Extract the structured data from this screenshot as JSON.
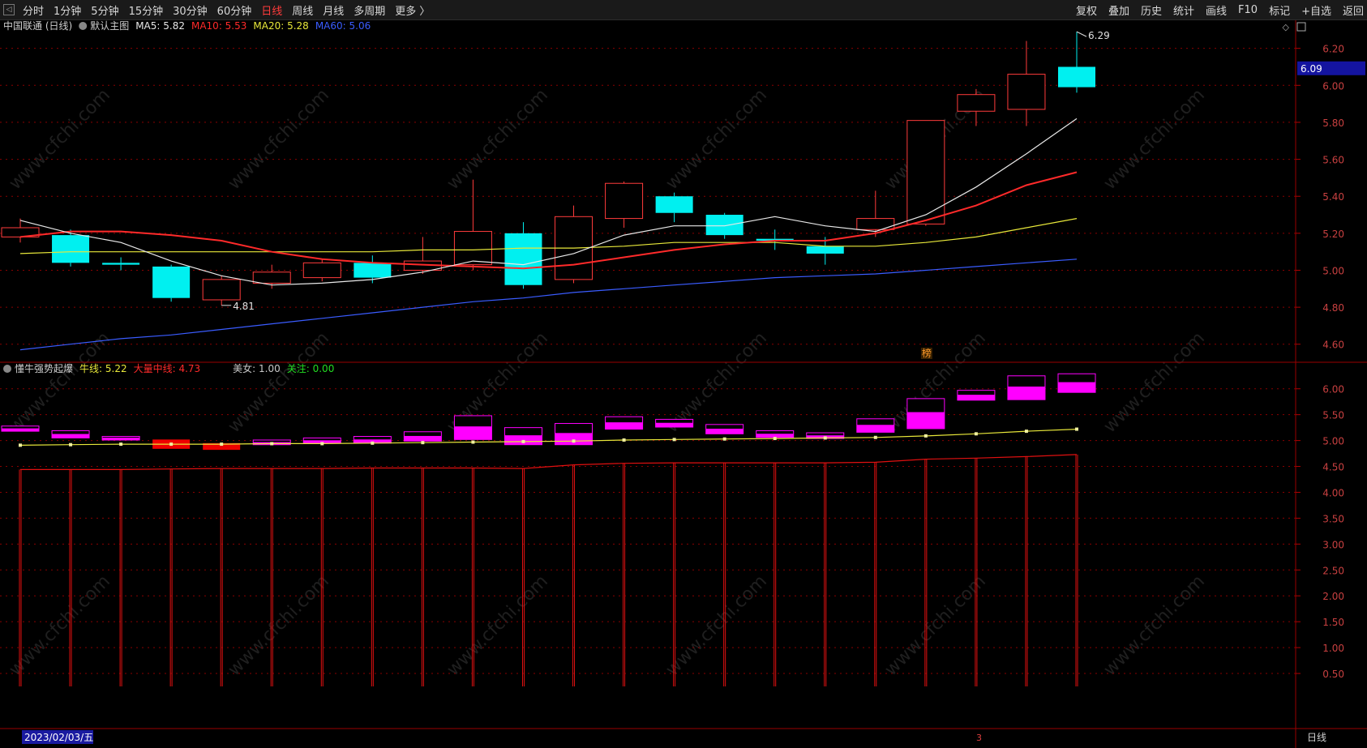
{
  "toolbar": {
    "collapse_icon": "chevron-left-icon",
    "periods": [
      "分时",
      "1分钟",
      "5分钟",
      "15分钟",
      "30分钟",
      "60分钟",
      "日线",
      "周线",
      "月线",
      "多周期",
      "更多 〉"
    ],
    "active_period": "日线",
    "right_items": [
      "复权",
      "叠加",
      "历史",
      "统计",
      "画线",
      "F10",
      "标记",
      "+自选",
      "返回"
    ]
  },
  "main_panel": {
    "title": "中国联通 (日线)",
    "template_icon": "gear-icon",
    "template": "默认主图",
    "indicators": [
      {
        "label": "MA5: 5.82",
        "color": "#e8e8e8"
      },
      {
        "label": "MA10: 5.53",
        "color": "#ff2a2a"
      },
      {
        "label": "MA20: 5.28",
        "color": "#e8e83a"
      },
      {
        "label": "MA60: 5.06",
        "color": "#3a5cff"
      }
    ],
    "y_ticks": [
      "6.20",
      "6.00",
      "5.80",
      "5.60",
      "5.40",
      "5.20",
      "5.00",
      "4.80",
      "4.60"
    ],
    "current_price": "6.09",
    "high_label": "6.29",
    "low_label": "4.81",
    "marker": "榜",
    "corner_icons": [
      "diamond-icon",
      "window-icon"
    ]
  },
  "sub_panel": {
    "title": "懂牛强势起爆",
    "indicators": [
      {
        "label": "牛线: 5.22",
        "color": "#e8e83a"
      },
      {
        "label": "大量中线: 4.73",
        "color": "#ff2a2a"
      },
      {
        "label": "美女: 1.00",
        "color": "#c8c8c8"
      },
      {
        "label": "关注: 0.00",
        "color": "#22dd22"
      }
    ],
    "y_ticks": [
      "6.00",
      "5.50",
      "5.00",
      "4.50",
      "4.00",
      "3.50",
      "3.00",
      "2.50",
      "2.00",
      "1.50",
      "1.00",
      "0.50"
    ]
  },
  "status_bar": {
    "date": "2023/02/03/五",
    "marker": "3",
    "period": "日线"
  },
  "watermark": "www.cfchi.com",
  "colors": {
    "up": "#ff3b3b",
    "down": "#00f0f0",
    "ma5": "#e8e8e8",
    "ma10": "#ff2a2a",
    "ma20": "#e8e83a",
    "ma60": "#3a5cff",
    "sub_up": "#ff00ff",
    "grid": "#8a0000"
  },
  "chart_data": {
    "type": "candlestick",
    "candles": [
      {
        "o": 5.18,
        "c": 5.23,
        "h": 5.28,
        "l": 5.15
      },
      {
        "o": 5.19,
        "c": 5.04,
        "h": 5.22,
        "l": 5.02
      },
      {
        "o": 5.04,
        "c": 5.03,
        "h": 5.07,
        "l": 5.0
      },
      {
        "o": 5.02,
        "c": 4.85,
        "h": 5.03,
        "l": 4.83
      },
      {
        "o": 4.84,
        "c": 4.95,
        "h": 4.97,
        "l": 4.81
      },
      {
        "o": 4.93,
        "c": 4.99,
        "h": 5.03,
        "l": 4.9
      },
      {
        "o": 4.96,
        "c": 5.04,
        "h": 5.06,
        "l": 4.94
      },
      {
        "o": 5.04,
        "c": 4.96,
        "h": 5.08,
        "l": 4.93
      },
      {
        "o": 5.0,
        "c": 5.05,
        "h": 5.18,
        "l": 4.98
      },
      {
        "o": 5.03,
        "c": 5.21,
        "h": 5.49,
        "l": 5.0
      },
      {
        "o": 5.2,
        "c": 4.92,
        "h": 5.26,
        "l": 4.9
      },
      {
        "o": 4.95,
        "c": 5.29,
        "h": 5.35,
        "l": 4.93
      },
      {
        "o": 5.28,
        "c": 5.47,
        "h": 5.48,
        "l": 5.23
      },
      {
        "o": 5.4,
        "c": 5.31,
        "h": 5.42,
        "l": 5.26
      },
      {
        "o": 5.3,
        "c": 5.19,
        "h": 5.31,
        "l": 5.17
      },
      {
        "o": 5.17,
        "c": 5.16,
        "h": 5.22,
        "l": 5.11
      },
      {
        "o": 5.13,
        "c": 5.09,
        "h": 5.18,
        "l": 5.03
      },
      {
        "o": 5.22,
        "c": 5.28,
        "h": 5.43,
        "l": 5.18
      },
      {
        "o": 5.25,
        "c": 5.81,
        "h": 5.81,
        "l": 5.24
      },
      {
        "o": 5.86,
        "c": 5.95,
        "h": 5.98,
        "l": 5.78
      },
      {
        "o": 5.87,
        "c": 6.06,
        "h": 6.24,
        "l": 5.78
      },
      {
        "o": 6.1,
        "c": 5.99,
        "h": 6.29,
        "l": 5.96
      }
    ],
    "ma5": [
      5.27,
      5.2,
      5.15,
      5.05,
      4.97,
      4.92,
      4.93,
      4.95,
      4.99,
      5.05,
      5.03,
      5.09,
      5.19,
      5.24,
      5.24,
      5.29,
      5.24,
      5.21,
      5.3,
      5.45,
      5.63,
      5.82
    ],
    "ma10": [
      5.18,
      5.21,
      5.21,
      5.19,
      5.16,
      5.1,
      5.06,
      5.04,
      5.03,
      5.02,
      5.01,
      5.03,
      5.07,
      5.11,
      5.14,
      5.16,
      5.16,
      5.2,
      5.27,
      5.35,
      5.46,
      5.53
    ],
    "ma20": [
      5.09,
      5.1,
      5.1,
      5.1,
      5.1,
      5.1,
      5.1,
      5.1,
      5.11,
      5.11,
      5.12,
      5.12,
      5.13,
      5.15,
      5.15,
      5.15,
      5.13,
      5.13,
      5.15,
      5.18,
      5.23,
      5.28
    ],
    "ma60": [
      4.57,
      4.6,
      4.63,
      4.65,
      4.68,
      4.71,
      4.74,
      4.77,
      4.8,
      4.83,
      4.85,
      4.88,
      4.9,
      4.92,
      4.94,
      4.96,
      4.97,
      4.98,
      5.0,
      5.02,
      5.04,
      5.06
    ],
    "y_range": [
      4.52,
      6.33
    ],
    "sub_y_range": [
      0.25,
      6.45
    ],
    "sub_boxes": [
      {
        "o": 5.18,
        "c": 5.28,
        "up": true
      },
      {
        "o": 5.05,
        "c": 5.19,
        "up": true
      },
      {
        "o": 5.01,
        "c": 5.08,
        "up": true
      },
      {
        "o": 4.84,
        "c": 5.02,
        "up": false
      },
      {
        "o": 4.82,
        "c": 4.95,
        "up": false
      },
      {
        "o": 4.92,
        "c": 5.01,
        "up": true
      },
      {
        "o": 4.95,
        "c": 5.05,
        "up": true
      },
      {
        "o": 4.95,
        "c": 5.08,
        "up": true
      },
      {
        "o": 4.99,
        "c": 5.17,
        "up": true
      },
      {
        "o": 5.02,
        "c": 5.48,
        "up": true
      },
      {
        "o": 4.92,
        "c": 5.25,
        "up": true
      },
      {
        "o": 4.92,
        "c": 5.33,
        "up": true
      },
      {
        "o": 5.22,
        "c": 5.46,
        "up": true
      },
      {
        "o": 5.26,
        "c": 5.41,
        "up": true
      },
      {
        "o": 5.13,
        "c": 5.31,
        "up": true
      },
      {
        "o": 5.06,
        "c": 5.19,
        "up": true
      },
      {
        "o": 5.04,
        "c": 5.15,
        "up": true
      },
      {
        "o": 5.16,
        "c": 5.42,
        "up": true
      },
      {
        "o": 5.23,
        "c": 5.81,
        "up": true
      },
      {
        "o": 5.78,
        "c": 5.97,
        "up": true
      },
      {
        "o": 5.79,
        "c": 6.25,
        "up": true
      },
      {
        "o": 5.93,
        "c": 6.29,
        "up": true
      }
    ],
    "niu_line": [
      4.91,
      4.92,
      4.93,
      4.93,
      4.93,
      4.94,
      4.94,
      4.95,
      4.96,
      4.97,
      4.98,
      4.99,
      5.01,
      5.02,
      5.03,
      5.04,
      5.05,
      5.06,
      5.09,
      5.13,
      5.18,
      5.22
    ],
    "volume_mid": [
      4.44,
      4.44,
      4.44,
      4.45,
      4.46,
      4.46,
      4.46,
      4.47,
      4.47,
      4.47,
      4.46,
      4.53,
      4.56,
      4.57,
      4.57,
      4.57,
      4.57,
      4.58,
      4.64,
      4.66,
      4.69,
      4.73
    ]
  }
}
